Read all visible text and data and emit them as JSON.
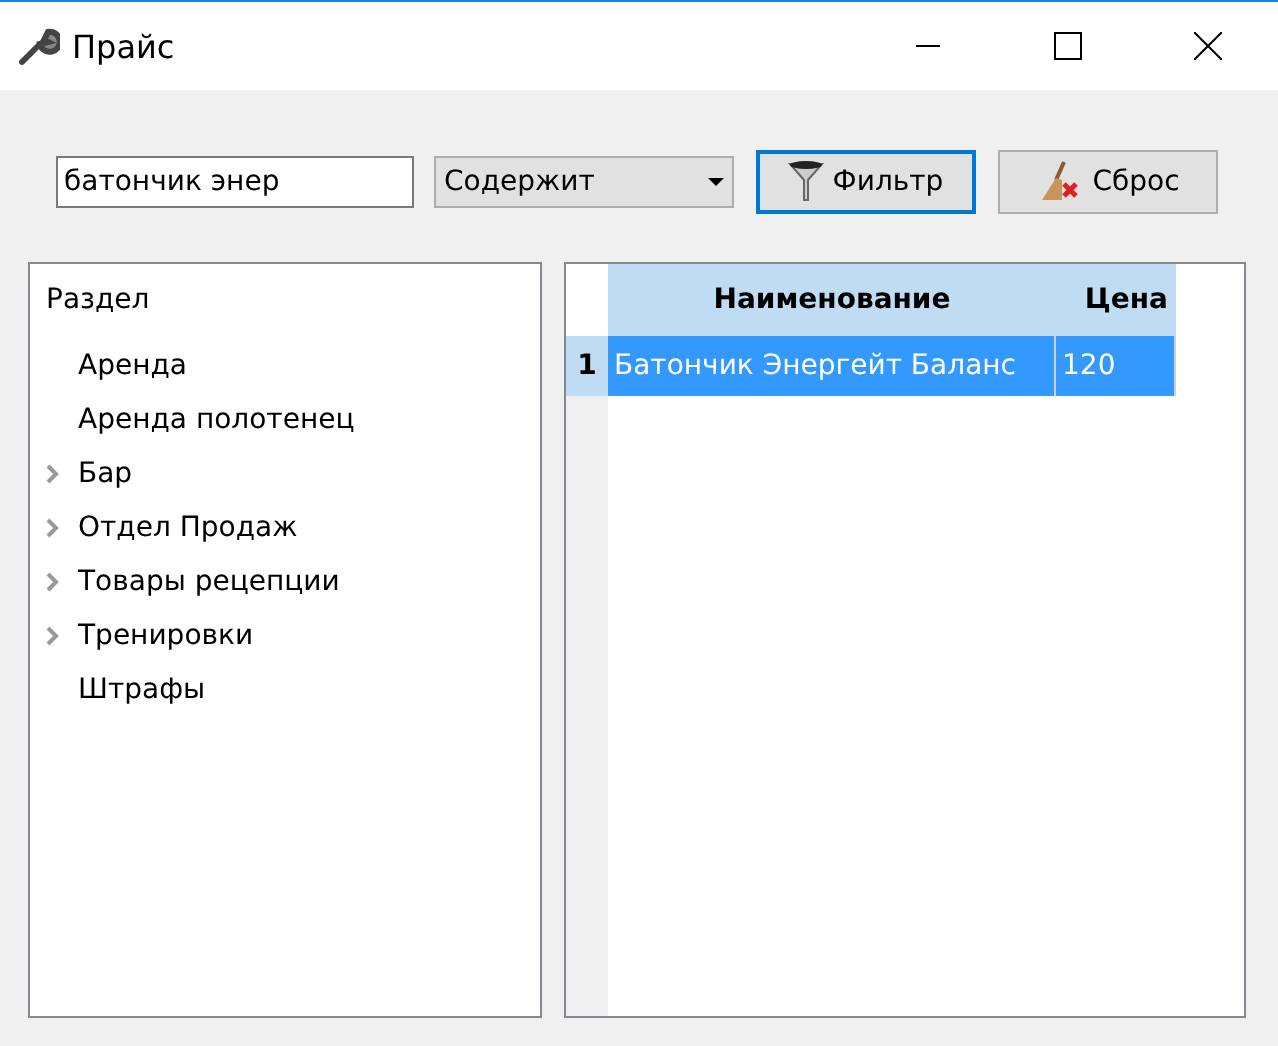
{
  "window": {
    "title": "Прайс"
  },
  "filter": {
    "query": "батончик энер",
    "mode": "Содержит",
    "buttons": [
      {
        "kind": "filter",
        "label": "Фильтр",
        "focused": true
      },
      {
        "kind": "reset",
        "label": "Сброс",
        "focused": false
      }
    ]
  },
  "tree": {
    "header": "Раздел",
    "items": [
      {
        "label": "Аренда",
        "has_children": false
      },
      {
        "label": "Аренда полотенец",
        "has_children": false
      },
      {
        "label": "Бар",
        "has_children": true
      },
      {
        "label": "Отдел Продаж",
        "has_children": true
      },
      {
        "label": "Товары рецепции",
        "has_children": true
      },
      {
        "label": "Тренировки",
        "has_children": true
      },
      {
        "label": "Штрафы",
        "has_children": false
      }
    ]
  },
  "table": {
    "columns": [
      "Наименование",
      "Цена"
    ],
    "rows": [
      {
        "number": "1",
        "cells": [
          "Батончик Энергейт Баланс",
          "120"
        ],
        "selected": true
      }
    ]
  }
}
